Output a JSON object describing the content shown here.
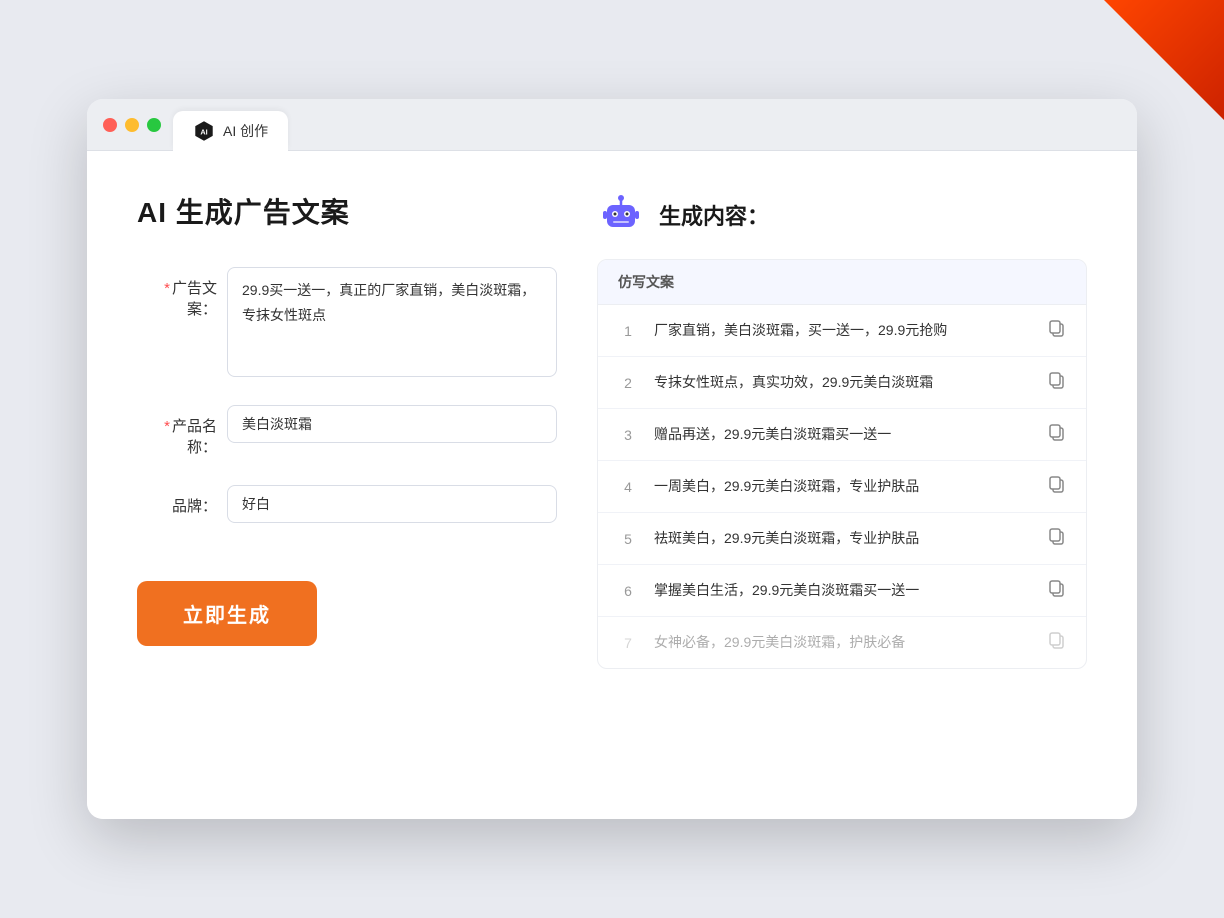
{
  "tab": {
    "label": "AI 创作"
  },
  "page": {
    "title": "AI 生成广告文案",
    "form": {
      "ad_copy_label": "广告文案：",
      "ad_copy_required": "*",
      "ad_copy_value": "29.9买一送一，真正的厂家直销，美白淡斑霜，专抹女性斑点",
      "product_name_label": "产品名称：",
      "product_name_required": "*",
      "product_name_value": "美白淡斑霜",
      "brand_label": "品牌：",
      "brand_value": "好白",
      "generate_btn": "立即生成"
    }
  },
  "result": {
    "header": "生成内容：",
    "table_header": "仿写文案",
    "items": [
      {
        "num": "1",
        "text": "厂家直销，美白淡斑霜，买一送一，29.9元抢购",
        "faded": false
      },
      {
        "num": "2",
        "text": "专抹女性斑点，真实功效，29.9元美白淡斑霜",
        "faded": false
      },
      {
        "num": "3",
        "text": "赠品再送，29.9元美白淡斑霜买一送一",
        "faded": false
      },
      {
        "num": "4",
        "text": "一周美白，29.9元美白淡斑霜，专业护肤品",
        "faded": false
      },
      {
        "num": "5",
        "text": "祛斑美白，29.9元美白淡斑霜，专业护肤品",
        "faded": false
      },
      {
        "num": "6",
        "text": "掌握美白生活，29.9元美白淡斑霜买一送一",
        "faded": false
      },
      {
        "num": "7",
        "text": "女神必备，29.9元美白淡斑霜，护肤必备",
        "faded": true
      }
    ]
  },
  "colors": {
    "orange": "#f07020",
    "accent_blue": "#5b8ff9",
    "required_red": "#ff4d4f"
  }
}
